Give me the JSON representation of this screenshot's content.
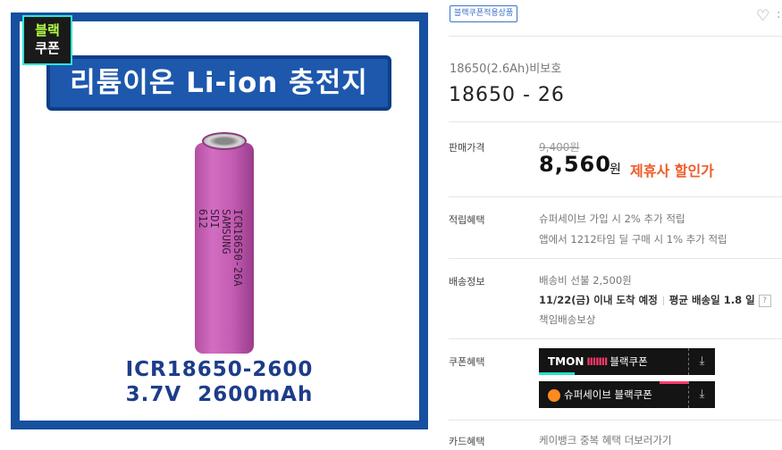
{
  "image": {
    "badge": {
      "line1": "블랙",
      "line2": "쿠폰"
    },
    "banner": "리튬이온 Li-ion 충전지",
    "battery_print": [
      "ICR18650-26A",
      "SAMSUNG",
      "SDI",
      "612"
    ],
    "spec_line1": "ICR18650-2600",
    "spec_line2": "3.7V  2600mAh",
    "colors": {
      "frame": "#1750a0",
      "battery": "#c25cb2"
    }
  },
  "header": {
    "tag": "블랙쿠폰적용상품",
    "heart_icon": "heart-outline-icon",
    "more_icon": "more-icon",
    "more_glyph": ":"
  },
  "product": {
    "subtitle": "18650(2.6Ah)비보호",
    "name": "18650 - 26"
  },
  "price": {
    "label": "판매가격",
    "original": "9,400원",
    "sale": "8,560",
    "currency": "원",
    "discount_label": "제휴사 할인가",
    "discount_color": "#f05a28"
  },
  "points": {
    "label": "적립혜택",
    "line1": "슈퍼세이브 가입 시 2% 추가 적립",
    "line2": "앱에서 1212타임 딜 구매 시 1% 추가 적립"
  },
  "shipping": {
    "label": "배송정보",
    "fee": "배송비 선불 2,500원",
    "arrival": "11/22(금) 이내 도착 예정",
    "average": "평균 배송일 1.8 일",
    "help": "?",
    "guarantee": "책임배송보상"
  },
  "coupons": {
    "label": "쿠폰혜택",
    "tmon_logo": "TMON",
    "tmon_stripe": "IIIIIII",
    "tmon_text": "블랙쿠폰",
    "safe_text": "슈퍼세이브 블랙쿠폰",
    "download_glyph": "⤓"
  },
  "card": {
    "label": "카드혜택",
    "text": "케이뱅크 중복 혜택 더보러가기"
  }
}
